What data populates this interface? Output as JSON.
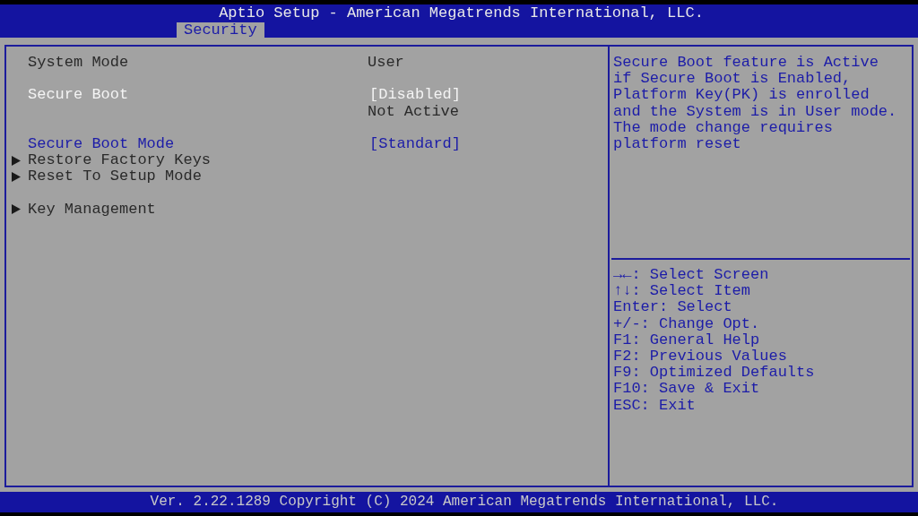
{
  "window": {
    "title": "Aptio Setup - American Megatrends International, LLC."
  },
  "tabs": [
    {
      "label": "Security",
      "selected": true
    }
  ],
  "items": [
    {
      "kind": "info",
      "label": "System Mode",
      "value": "User"
    },
    {
      "kind": "blank"
    },
    {
      "kind": "option",
      "label": "Secure Boot",
      "value": "[Disabled]",
      "selected": true
    },
    {
      "kind": "info",
      "value": "Not Active"
    },
    {
      "kind": "blank"
    },
    {
      "kind": "option",
      "label": "Secure Boot Mode",
      "value": "[Standard]",
      "selected": false
    },
    {
      "kind": "submenu",
      "label": "Restore Factory Keys",
      "selected": false
    },
    {
      "kind": "submenu",
      "label": "Reset To Setup Mode",
      "selected": false
    },
    {
      "kind": "blank"
    },
    {
      "kind": "submenu",
      "label": "Key Management",
      "selected": false
    }
  ],
  "help_lines": [
    "Secure Boot feature is Active",
    "if Secure Boot is Enabled,",
    "Platform Key(PK) is enrolled",
    "and the System is in User mode.",
    "The mode change requires",
    "platform reset"
  ],
  "key_hints": [
    "→←: Select Screen",
    "↑↓: Select Item",
    "Enter: Select",
    "+/-: Change Opt.",
    "F1: General Help",
    "F2: Previous Values",
    "F9: Optimized Defaults",
    "F10: Save & Exit",
    "ESC: Exit"
  ],
  "status_bar": "Ver. 2.22.1289 Copyright (C) 2024 American Megatrends International, LLC."
}
